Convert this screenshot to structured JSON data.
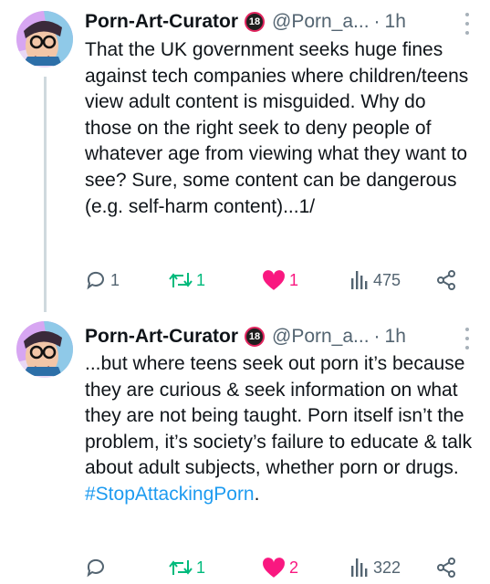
{
  "tweets": [
    {
      "author_name": "Porn-Art-Curator",
      "badge": "18",
      "handle": "@Porn_a...",
      "separator": "·",
      "time": "1h",
      "text": "That the UK government seeks huge fines against tech companies where children/teens view adult content is misguided. Why do those on the right seek to deny people of whatever age from viewing what they want to see? Sure, some content can be dangerous (e.g. self-harm content)...1/",
      "hashtag": "",
      "replies": "1",
      "retweets": "1",
      "likes": "1",
      "views": "475"
    },
    {
      "author_name": "Porn-Art-Curator",
      "badge": "18",
      "handle": "@Porn_a...",
      "separator": "·",
      "time": "1h",
      "text": "...but where teens seek out porn it’s because they are curious & seek information on what they are not being taught. Porn itself isn’t the problem, it’s society’s failure to educate & talk about adult subjects, whether porn or drugs.",
      "hashtag": "#StopAttackingPorn",
      "hashtag_suffix": ".",
      "replies": "",
      "retweets": "1",
      "likes": "2",
      "views": "322"
    }
  ],
  "colors": {
    "accent": "#1d9bf0",
    "retweet": "#00ba7c",
    "like": "#f91880",
    "secondary_text": "#536471"
  },
  "icons": [
    "reply-icon",
    "retweet-icon",
    "heart-icon",
    "views-icon",
    "share-icon",
    "more-icon",
    "age-18-badge-icon"
  ]
}
